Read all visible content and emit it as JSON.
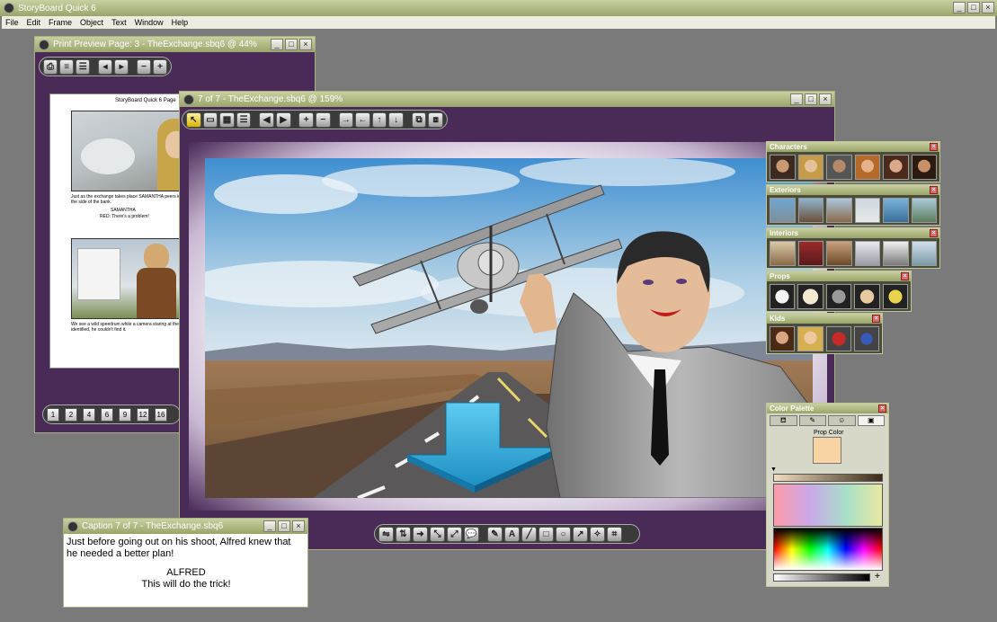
{
  "app": {
    "title": "StoryBoard Quick 6"
  },
  "menu": [
    "File",
    "Edit",
    "Frame",
    "Object",
    "Text",
    "Window",
    "Help"
  ],
  "print_preview": {
    "title": "Print Preview Page: 3 - TheExchange.sbq6 @ 44%",
    "page_header": "StoryBoard Quick 6 Page",
    "panel1_caption": "Just as the exchange takes place SAMANTHA peers in from the side of the bank.",
    "panel1_speaker": "SAMANTHA",
    "panel1_line": "RED: There's a problem!",
    "panel2_caption": "We see a wild speedrum while a camera staring at the guy identified, he couldn't find it.",
    "page_numbers": [
      "1",
      "2",
      "4",
      "6",
      "9",
      "12",
      "16"
    ]
  },
  "frame_window": {
    "title": "7 of 7 - TheExchange.sbq6 @ 159%"
  },
  "caption": {
    "title": "Caption 7 of 7 - TheExchange.sbq6",
    "line1": "Just before going out on his shoot, Alfred knew that",
    "line2": "he needed a better plan!",
    "speaker": "ALFRED",
    "dialogue": "This will do the trick!"
  },
  "palettes": {
    "characters": "Characters",
    "exteriors": "Exteriors",
    "interiors": "Interiors",
    "props": "Props",
    "kids": "Kids"
  },
  "color_palette": {
    "title": "Color Palette",
    "label": "Prop Color",
    "swatch": "#f8d3a4"
  },
  "colors": {
    "frame_purple": "#4a2a57",
    "titlebar_green": "#a8b27a",
    "desktop": "#7a7a7a"
  }
}
